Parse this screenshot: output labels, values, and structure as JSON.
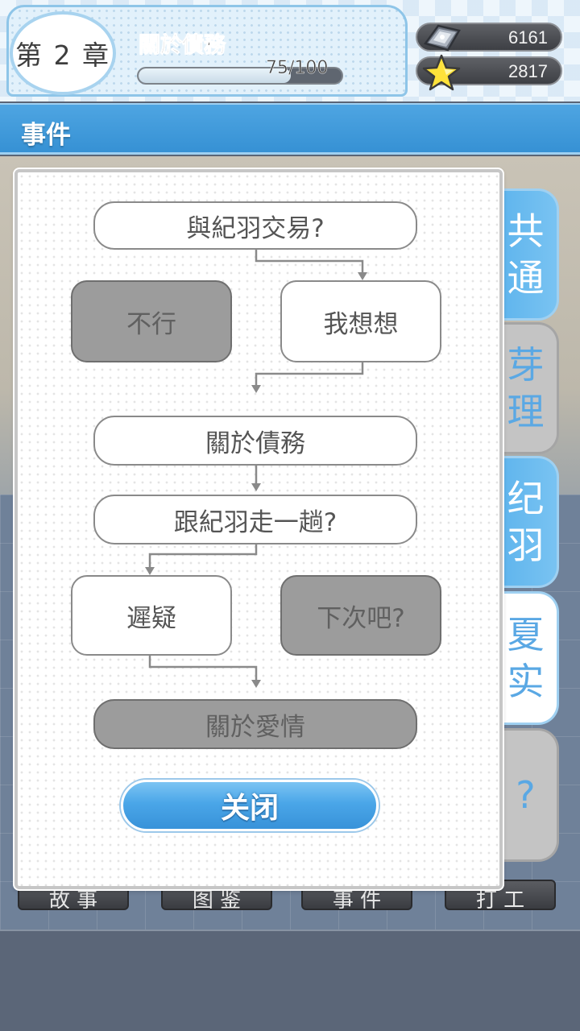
{
  "header": {
    "chapter": "第 2 章",
    "chapter_title": "關於債務",
    "progress_text": "75/100",
    "progress": {
      "current": 75,
      "max": 100
    }
  },
  "resources": {
    "gems": {
      "value": "6161",
      "icon": "gem-icon"
    },
    "stars": {
      "value": "2817",
      "icon": "star-icon"
    }
  },
  "event_bar": {
    "title": "事件"
  },
  "flowchart": {
    "nodes": [
      {
        "id": "trade",
        "label": "與紀羽交易?",
        "state": "normal"
      },
      {
        "id": "refuse",
        "label": "不行",
        "state": "disabled"
      },
      {
        "id": "think",
        "label": "我想想",
        "state": "normal"
      },
      {
        "id": "debt",
        "label": "關於債務",
        "state": "normal"
      },
      {
        "id": "walk",
        "label": "跟紀羽走一趟?",
        "state": "normal"
      },
      {
        "id": "hesitate",
        "label": "遲疑",
        "state": "normal"
      },
      {
        "id": "next_time",
        "label": "下次吧?",
        "state": "disabled"
      },
      {
        "id": "love",
        "label": "關於愛情",
        "state": "disabled"
      }
    ]
  },
  "close_button": {
    "label": "关闭"
  },
  "tabs": [
    {
      "label": [
        "共",
        "通"
      ],
      "state": "selected"
    },
    {
      "label": [
        "芽",
        "理"
      ],
      "state": "inactive"
    },
    {
      "label": [
        "纪",
        "羽"
      ],
      "state": "selected"
    },
    {
      "label": [
        "夏",
        "实"
      ],
      "state": "active"
    },
    {
      "label": [
        "?"
      ],
      "state": "inactive"
    }
  ],
  "bottom_nav": [
    {
      "label": "故 事"
    },
    {
      "label": "图 鉴"
    },
    {
      "label": "事 件"
    },
    {
      "label": "打 工"
    }
  ],
  "colors": {
    "accent": "#4aa6e8",
    "header_bar": "#3691d4",
    "node_disabled": "#9c9c9c"
  }
}
